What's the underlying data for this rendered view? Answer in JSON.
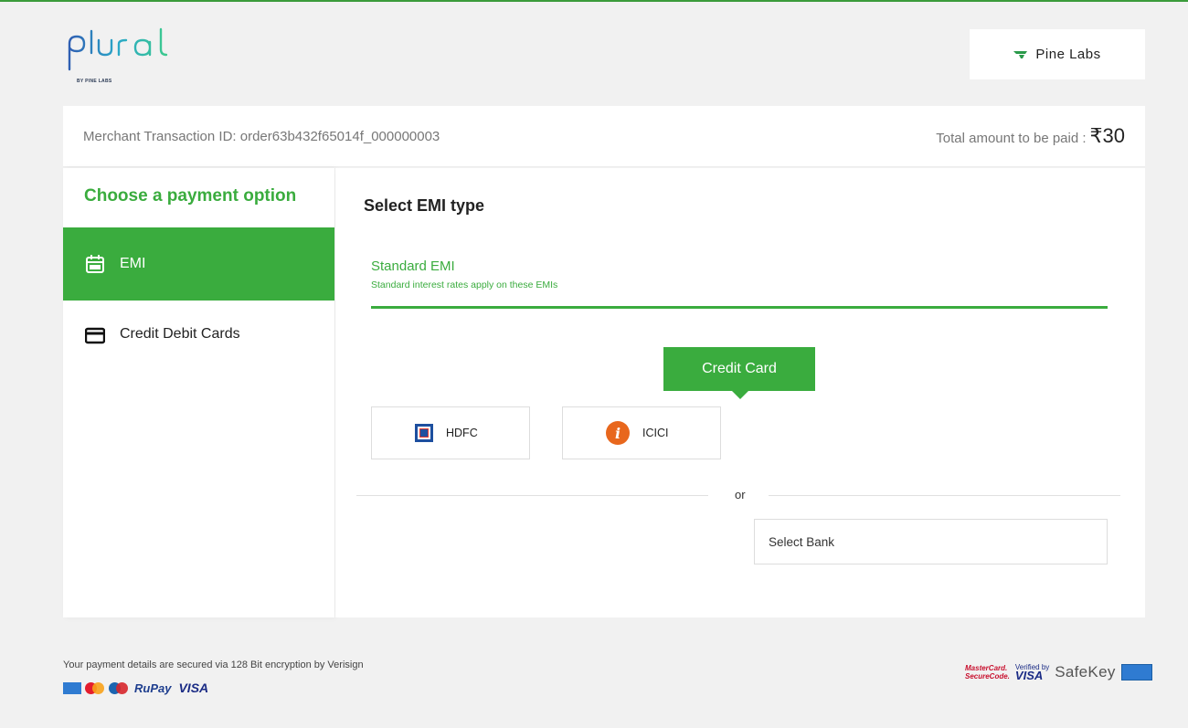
{
  "header": {
    "brand_sub": "BY PINE LABS",
    "partner_name": "Pine Labs"
  },
  "transaction": {
    "merchant_id_text": "Merchant Transaction ID: order63b432f65014f_000000003",
    "total_label": "Total amount to be paid :",
    "total_amount": "₹30"
  },
  "sidebar": {
    "title": "Choose a payment option",
    "items": [
      {
        "label": "EMI",
        "icon": "emi-calendar-icon",
        "active": true
      },
      {
        "label": "Credit Debit Cards",
        "icon": "card-icon",
        "active": false
      }
    ]
  },
  "main": {
    "title": "Select EMI type",
    "emi_type": {
      "title": "Standard EMI",
      "subtitle": "Standard interest rates apply on these EMIs"
    },
    "card_tab": "Credit Card",
    "banks": [
      {
        "label": "HDFC",
        "icon": "hdfc-logo-icon"
      },
      {
        "label": "ICICI",
        "icon": "icici-logo-icon"
      }
    ],
    "or_text": "or",
    "select_bank": "Select Bank"
  },
  "footer": {
    "secure_text": "Your payment details are secured via 128 Bit encryption by Verisign",
    "rupay": "RuPay",
    "visa": "VISA",
    "mastercard_line1": "MasterCard.",
    "mastercard_line2": "SecureCode.",
    "vbv_line1": "Verified by",
    "vbv_line2": "VISA",
    "safekey": "SafeKey"
  },
  "colors": {
    "accent_green": "#3aac3e",
    "background": "#f1f1f1"
  }
}
